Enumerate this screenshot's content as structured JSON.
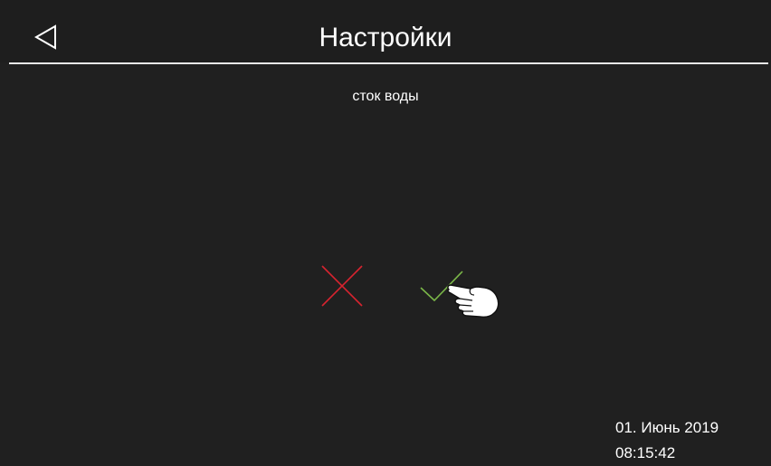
{
  "header": {
    "title": "Настройки",
    "back_icon": "back-triangle-icon"
  },
  "setting": {
    "name": "сток воды"
  },
  "actions": {
    "cancel_icon": "cross-icon",
    "cancel_color": "#d7232f",
    "confirm_icon": "checkmark-icon",
    "confirm_color": "#7ab648"
  },
  "status": {
    "date": "01. Июнь 2019",
    "time": "08:15:42"
  },
  "colors": {
    "background": "#202020",
    "header_line": "#e8e8e8",
    "text": "#ffffff"
  }
}
